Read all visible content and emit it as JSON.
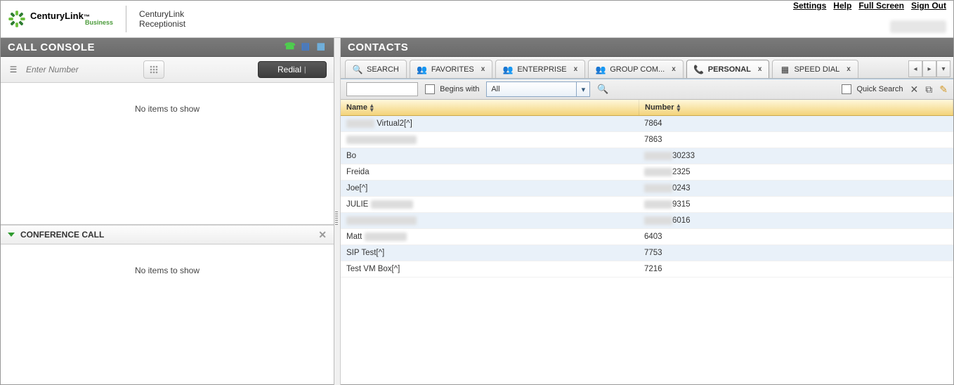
{
  "top_links": {
    "settings": "Settings",
    "help": "Help",
    "full_screen": "Full Screen",
    "sign_out": "Sign Out"
  },
  "header": {
    "brand_upper": "CenturyLink",
    "brand_lower": "Business",
    "app_title_line1": "CenturyLink",
    "app_title_line2": "Receptionist"
  },
  "call_console": {
    "title": "CALL CONSOLE",
    "enter_number_placeholder": "Enter Number",
    "redial": "Redial",
    "no_items": "No items to show"
  },
  "conference": {
    "title": "CONFERENCE CALL",
    "no_items": "No items to show"
  },
  "contacts": {
    "title": "CONTACTS",
    "tabs": {
      "search": "SEARCH",
      "favorites": "FAVORITES",
      "enterprise": "ENTERPRISE",
      "group": "GROUP COM...",
      "personal": "PERSONAL",
      "speed_dial": "SPEED DIAL"
    },
    "filter": {
      "begins_with": "Begins with",
      "select_value": "All",
      "quick_search": "Quick Search"
    },
    "columns": {
      "name": "Name",
      "number": "Number"
    },
    "rows": [
      {
        "name_blur_before": true,
        "name_text": "Virtual2[^]",
        "num_blur_before": false,
        "number": "7864"
      },
      {
        "name_blur_before": true,
        "name_text": "",
        "num_blur_before": false,
        "number": "7863"
      },
      {
        "name_blur_before": false,
        "name_text": "Bo",
        "num_blur_before": true,
        "number": "30233"
      },
      {
        "name_blur_before": false,
        "name_text": "Freida",
        "num_blur_before": true,
        "number": "2325"
      },
      {
        "name_blur_before": false,
        "name_text": "Joe[^]",
        "num_blur_before": true,
        "number": "0243"
      },
      {
        "name_blur_before": false,
        "name_text": "JULIE",
        "name_blur_after": true,
        "num_blur_before": true,
        "number": "9315"
      },
      {
        "name_blur_before": true,
        "name_text": "",
        "num_blur_before": true,
        "number": "6016"
      },
      {
        "name_blur_before": false,
        "name_text": "Matt",
        "name_blur_after": true,
        "num_blur_before": false,
        "number": "6403"
      },
      {
        "name_blur_before": false,
        "name_text": "SIP Test[^]",
        "num_blur_before": false,
        "number": "7753"
      },
      {
        "name_blur_before": false,
        "name_text": "Test VM Box[^]",
        "num_blur_before": false,
        "number": "7216"
      }
    ]
  }
}
